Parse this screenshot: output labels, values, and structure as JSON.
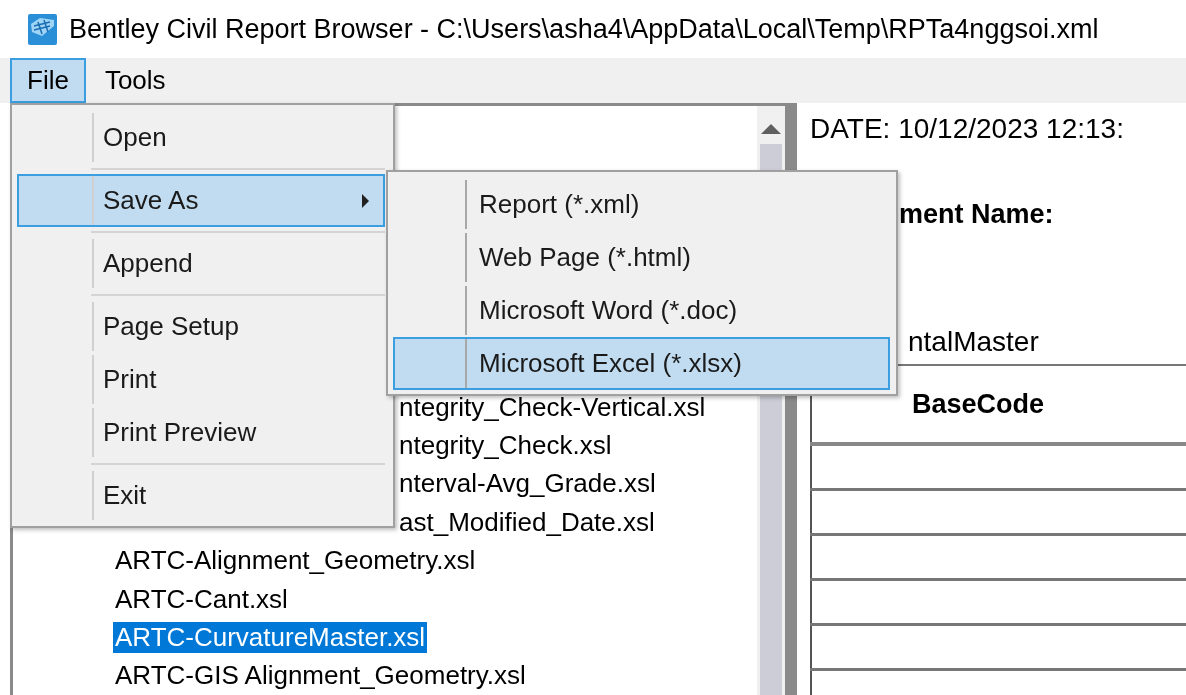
{
  "window": {
    "title": "Bentley Civil Report Browser - C:\\Users\\asha4\\AppData\\Local\\Temp\\RPTa4nggsoi.xml"
  },
  "menu_bar": [
    {
      "label": "File",
      "selected": true
    },
    {
      "label": "Tools",
      "selected": false
    }
  ],
  "file_menu": {
    "items": [
      {
        "kind": "item",
        "label": "Open",
        "selected": false
      },
      {
        "kind": "separator"
      },
      {
        "kind": "submenu",
        "label": "Save As",
        "selected": true
      },
      {
        "kind": "separator"
      },
      {
        "kind": "item",
        "label": "Append",
        "selected": false
      },
      {
        "kind": "separator"
      },
      {
        "kind": "item",
        "label": "Page Setup",
        "selected": false
      },
      {
        "kind": "item",
        "label": "Print",
        "selected": false
      },
      {
        "kind": "item",
        "label": "Print Preview",
        "selected": false
      },
      {
        "kind": "separator"
      },
      {
        "kind": "item",
        "label": "Exit",
        "selected": false
      }
    ]
  },
  "save_as_menu": {
    "items": [
      {
        "label": "Report (*.xml)",
        "selected": false
      },
      {
        "label": "Web Page (*.html)",
        "selected": false
      },
      {
        "label": "Microsoft Word (*.doc)",
        "selected": false
      },
      {
        "label": "Microsoft Excel (*.xlsx)",
        "selected": true
      }
    ]
  },
  "report_list": {
    "items": [
      {
        "label": "ntegrity_Check-Vertical.xsl",
        "partly_hidden": true,
        "selected": false
      },
      {
        "label": "ntegrity_Check.xsl",
        "partly_hidden": true,
        "selected": false
      },
      {
        "label": "nterval-Avg_Grade.xsl",
        "partly_hidden": true,
        "selected": false
      },
      {
        "label": "ast_Modified_Date.xsl",
        "partly_hidden": true,
        "selected": false
      },
      {
        "label": "ARTC-Alignment_Geometry.xsl",
        "partly_hidden": false,
        "selected": false
      },
      {
        "label": "ARTC-Cant.xsl",
        "partly_hidden": false,
        "selected": false
      },
      {
        "label": "ARTC-CurvatureMaster.xsl",
        "partly_hidden": false,
        "selected": true
      },
      {
        "label": "ARTC-GIS Alignment_Geometry.xsl",
        "partly_hidden": false,
        "selected": false
      }
    ]
  },
  "report": {
    "date": "DATE: 10/12/2023 12:13:",
    "name_label": "ment Name:",
    "name_value": "ntalMaster",
    "table": {
      "columns": [
        "BaseCode"
      ]
    }
  }
}
